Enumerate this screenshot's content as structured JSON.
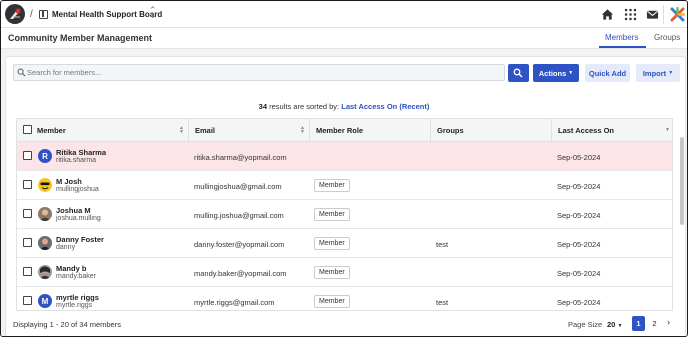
{
  "topbar": {
    "separator": "/",
    "board_name": "Mental Health Support Board",
    "icons": [
      "home-icon",
      "apps-grid-icon",
      "mail-icon",
      "brand-cross-icon"
    ]
  },
  "header": {
    "title": "Community Member Management",
    "tabs": [
      {
        "label": "Members",
        "active": true
      },
      {
        "label": "Groups",
        "active": false
      }
    ]
  },
  "toolbar": {
    "search_placeholder": "Search for members...",
    "actions_label": "Actions",
    "quick_add_label": "Quick Add",
    "import_label": "Import"
  },
  "results": {
    "count": "34",
    "text": "results are sorted by:",
    "sort_key": "Last Access On (Recent)"
  },
  "table": {
    "columns": [
      "Member",
      "Email",
      "Member Role",
      "Groups",
      "Last Access On"
    ],
    "rows": [
      {
        "name": "Ritika Sharma",
        "handle": "ritika.sharma",
        "email": "ritika.sharma@yopmail.com",
        "role": "",
        "group": "",
        "last_access": "Sep-05-2024",
        "avatar": "R",
        "highlight": true
      },
      {
        "name": "M Josh",
        "handle": "mullingjoshua",
        "email": "mullingjoshua@gmail.com",
        "role": "Member",
        "group": "",
        "last_access": "Sep-05-2024",
        "avatar": "emoji-face-icon"
      },
      {
        "name": "Joshua M",
        "handle": "joshua.mulling",
        "email": "mulling.joshua@gmail.com",
        "role": "Member",
        "group": "",
        "last_access": "Sep-05-2024",
        "avatar": "photo-icon"
      },
      {
        "name": "Danny Foster",
        "handle": "danny",
        "email": "danny.foster@yopmail.com",
        "role": "Member",
        "group": "test",
        "last_access": "Sep-05-2024",
        "avatar": "photo-icon"
      },
      {
        "name": "Mandy b",
        "handle": "mandy.baker",
        "email": "mandy.baker@yopmail.com",
        "role": "Member",
        "group": "",
        "last_access": "Sep-05-2024",
        "avatar": "photo-icon"
      },
      {
        "name": "myrtle riggs",
        "handle": "myrtle.riggs",
        "email": "myrtle.riggs@gmail.com",
        "role": "Member",
        "group": "test",
        "last_access": "Sep-05-2024",
        "avatar": "M"
      }
    ]
  },
  "footer": {
    "displaying": "Displaying 1 - 20 of 34 members",
    "page_size_label": "Page Size",
    "page_size_value": "20",
    "pages": [
      "1",
      "2"
    ],
    "current_page": "1",
    "next_symbol": "›"
  },
  "colors": {
    "accent": "#2d53c5",
    "highlight_row": "#fbe5e8",
    "light_button": "#e4eafa"
  }
}
